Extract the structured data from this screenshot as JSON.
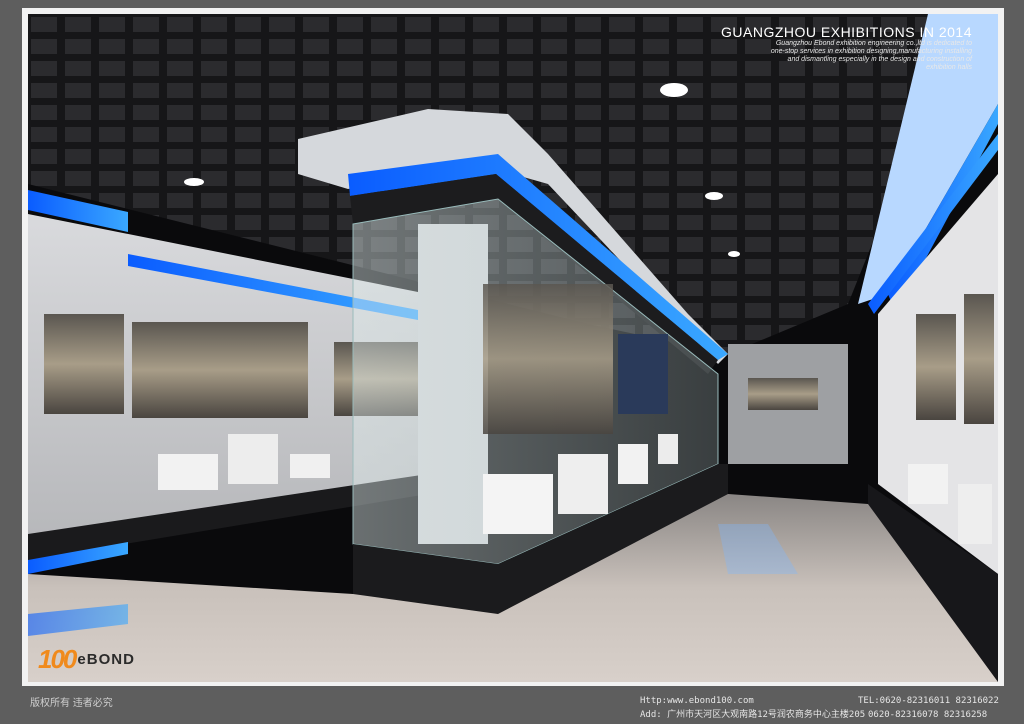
{
  "banner": {
    "title": "GUANGZHOU EXHIBITIONS IN 2014",
    "description": "Guangzhou Ebond exhibition engineering co.,ltd is dedicated to one-stop services in exhibition designing,manufacturing installing and dismantling especially in the design and construction of exhibition halls"
  },
  "logo": {
    "number": "100",
    "word": "eBOND"
  },
  "footer": {
    "copyright": "版权所有 违者必究",
    "website": "Http:www.ebond100.com",
    "address": "Add: 广州市天河区大观南路12号润农商务中心主楼205",
    "tel": "TEL:0620-82316011 82316022",
    "tel2": "0620-82316078 82316258"
  },
  "colors": {
    "accent_blue": "#1e8bff",
    "logo_orange": "#f08a1c",
    "frame_gray": "#5e5e5e"
  }
}
